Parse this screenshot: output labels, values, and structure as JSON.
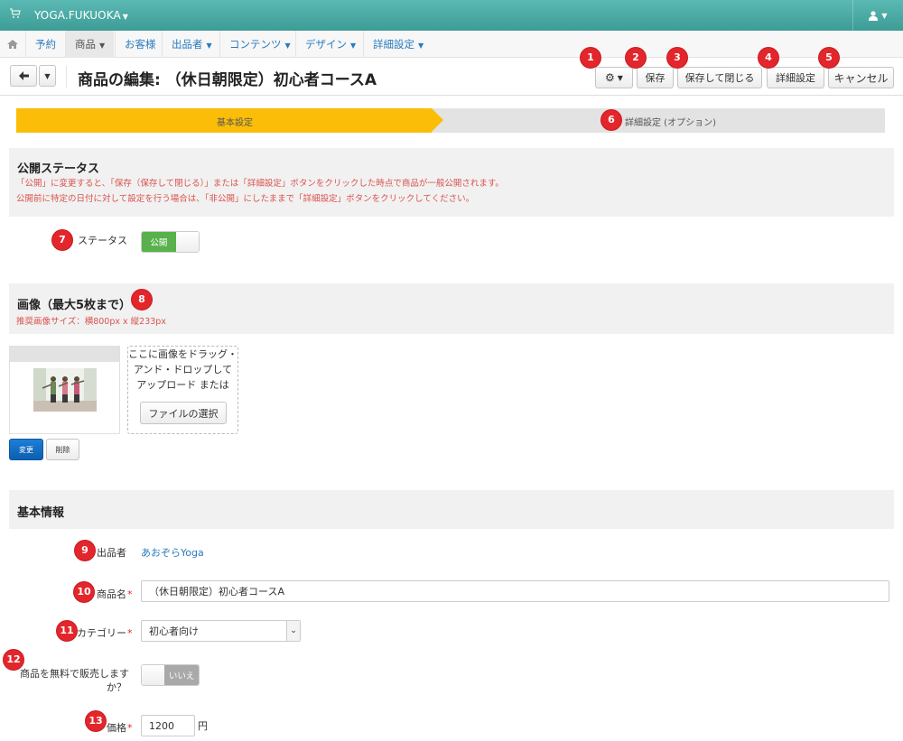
{
  "topbar": {
    "brand": "YOGA.FUKUOKA"
  },
  "nav": {
    "items": [
      {
        "label": "予約",
        "caret": false
      },
      {
        "label": "商品",
        "caret": true
      },
      {
        "label": "お客様",
        "caret": false
      },
      {
        "label": "出品者",
        "caret": true
      },
      {
        "label": "コンテンツ",
        "caret": true
      },
      {
        "label": "デザイン",
        "caret": true
      },
      {
        "label": "詳細設定",
        "caret": true
      }
    ]
  },
  "title": "商品の編集: （休日朝限定）初心者コースA",
  "toolbar": {
    "save": "保存",
    "save_close": "保存して閉じる",
    "advanced": "詳細設定",
    "cancel": "キャンセル"
  },
  "markers": [
    "1",
    "2",
    "3",
    "4",
    "5",
    "6",
    "7",
    "8",
    "9",
    "10",
    "11",
    "12",
    "13"
  ],
  "wizard": {
    "step1": "基本設定",
    "step2": "詳細設定 (オプション)"
  },
  "publish": {
    "heading": "公開ステータス",
    "note1": "「公開」に変更すると、「保存（保存して閉じる）」または「詳細設定」ボタンをクリックした時点で商品が一般公開されます。",
    "note2": "公開前に特定の日付に対して設定を行う場合は、「非公開」にしたままで「詳細設定」ボタンをクリックしてください。",
    "status_label": "ステータス",
    "status_value": "公開"
  },
  "images": {
    "heading": "画像（最大5枚まで）",
    "note": "推奨画像サイズ：横800px x 縦233px",
    "drop_text": [
      "ここに画像をドラッグ・",
      "アンド・ドロップして",
      "アップロード または"
    ],
    "choose_file": "ファイルの選択",
    "change": "変更",
    "delete": "削除"
  },
  "basic": {
    "heading": "基本情報",
    "seller_label": "出品者",
    "seller_value": "あおぞらYoga",
    "name_label": "商品名",
    "name_value": "（休日朝限定）初心者コースA",
    "category_label": "カテゴリー",
    "category_value": "初心者向け",
    "free_label_1": "商品を無料で販売します",
    "free_label_2": "か？",
    "free_value": "いいえ",
    "price_label": "価格",
    "price_value": "1200",
    "price_unit": "円"
  },
  "colors": {
    "topbar": "#4aa9a3",
    "accent": "#fbbd08",
    "marker": "#e3262b",
    "link": "#2a7bbd"
  }
}
